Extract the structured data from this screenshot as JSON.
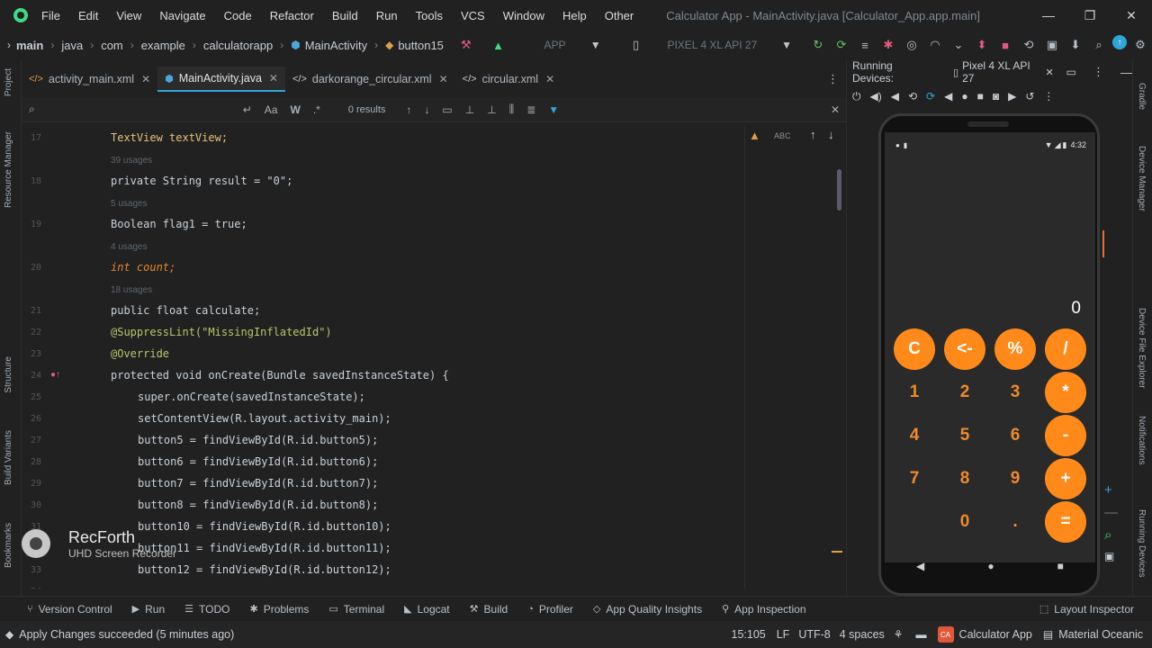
{
  "menu": {
    "items": [
      "File",
      "Edit",
      "View",
      "Navigate",
      "Code",
      "Refactor",
      "Build",
      "Run",
      "Tools",
      "VCS",
      "Window",
      "Help",
      "Other"
    ],
    "window_title": "Calculator App - MainActivity.java [Calculator_App.app.main]",
    "controls": {
      "minimize": "—",
      "restore": "❐",
      "close": "✕"
    }
  },
  "breadcrumbs": [
    "main",
    "java",
    "com",
    "example",
    "calculatorapp",
    "MainActivity",
    "button15"
  ],
  "run_config": {
    "app": "APP",
    "device": "PIXEL 4 XL API 27"
  },
  "tabs": [
    {
      "label": "activity_main.xml",
      "icon": "xml-file-icon"
    },
    {
      "label": "MainActivity.java",
      "icon": "java-class-icon",
      "active": true
    },
    {
      "label": "darkorange_circular.xml",
      "icon": "xml-file-icon"
    },
    {
      "label": "circular.xml",
      "icon": "xml-file-icon"
    }
  ],
  "search": {
    "value": "",
    "results": "0 results"
  },
  "editor": {
    "lines": [
      {
        "num": "17",
        "code": "TextView textView;"
      },
      {
        "usage": "39 usages"
      },
      {
        "num": "18",
        "code": "private String result = \"0\";"
      },
      {
        "usage": "5 usages"
      },
      {
        "num": "19",
        "code": "Boolean flag1 = true;"
      },
      {
        "usage": "4 usages"
      },
      {
        "num": "20",
        "code": "int count;"
      },
      {
        "usage": "18 usages"
      },
      {
        "num": "21",
        "code": "public float calculate;"
      },
      {
        "num": "22",
        "code": "@SuppressLint(\"MissingInflatedId\")"
      },
      {
        "num": "23",
        "code": "@Override"
      },
      {
        "num": "24",
        "code": "protected void onCreate(Bundle savedInstanceState) {"
      },
      {
        "num": "25",
        "code": "super.onCreate(savedInstanceState);"
      },
      {
        "num": "26",
        "code": "setContentView(R.layout.activity_main);"
      },
      {
        "num": "27",
        "code": "button5 = findViewById(R.id.button5);"
      },
      {
        "num": "28",
        "code": "button6 = findViewById(R.id.button6);"
      },
      {
        "num": "29",
        "code": "button7 = findViewById(R.id.button7);"
      },
      {
        "num": "30",
        "code": "button8 = findViewById(R.id.button8);"
      },
      {
        "num": "31",
        "code": "button10 = findViewById(R.id.button10);"
      },
      {
        "num": "32",
        "code": "button11 = findViewById(R.id.button11);"
      },
      {
        "num": "33",
        "code": "button12 = findViewById(R.id.button12);"
      },
      {
        "num": "34",
        "code": ""
      }
    ]
  },
  "device_panel": {
    "title": "Running Devices:",
    "device_tab": "Pixel 4 XL API 27"
  },
  "phone": {
    "time": "4:32",
    "display": "0",
    "buttons": [
      [
        "C",
        "<-",
        "%",
        "/"
      ],
      [
        "1",
        "2",
        "3",
        "*"
      ],
      [
        "4",
        "5",
        "6",
        "-"
      ],
      [
        "7",
        "8",
        "9",
        "+"
      ],
      [
        "",
        "0",
        ".",
        "="
      ]
    ]
  },
  "side_labels": {
    "left": [
      "Project",
      "Resource Manager",
      "Structure",
      "Build Variants",
      "Bookmarks"
    ],
    "right": [
      "Gradle",
      "Device Manager",
      "Device File Explorer",
      "Notifications",
      "Running Devices"
    ]
  },
  "bottom_tools": [
    "Version Control",
    "Run",
    "TODO",
    "Problems",
    "Terminal",
    "Logcat",
    "Build",
    "Profiler",
    "App Quality Insights",
    "App Inspection"
  ],
  "layout_inspector": "Layout Inspector",
  "status": {
    "message": "Apply Changes succeeded (5 minutes ago)",
    "position": "15:105",
    "line_sep": "LF",
    "encoding": "UTF-8",
    "indent": "4 spaces",
    "project": "Calculator App",
    "theme": "Material Oceanic"
  },
  "watermark": {
    "title": "RecForth",
    "subtitle": "UHD Screen Recorder"
  },
  "colors": {
    "accent": "#2ea6d6",
    "calc_orange": "#ff8a1a",
    "keyword": "#e8822d"
  }
}
